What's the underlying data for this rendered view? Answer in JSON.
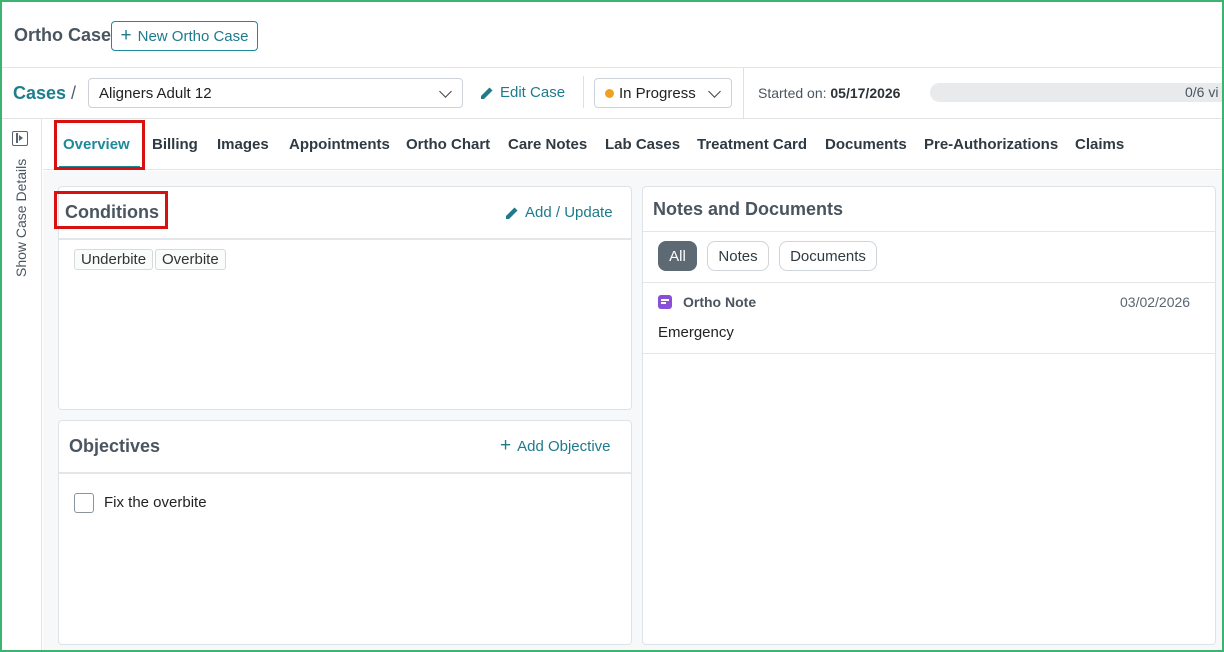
{
  "header": {
    "title": "Ortho Case",
    "new_case_label": "New Ortho Case"
  },
  "case_bar": {
    "breadcrumb_root": "Cases",
    "breadcrumb_sep": "/",
    "selected_case": "Aligners Adult 12",
    "edit_label": "Edit Case",
    "status": "In Progress",
    "status_color": "#f0a020",
    "started_label": "Started on:",
    "started_date": "05/17/2026",
    "progress_text": "0/6 vi",
    "progress_fraction": 0
  },
  "rail": {
    "label": "Show Case Details"
  },
  "tabs": [
    {
      "label": "Overview"
    },
    {
      "label": "Billing"
    },
    {
      "label": "Images"
    },
    {
      "label": "Appointments"
    },
    {
      "label": "Ortho Chart"
    },
    {
      "label": "Care Notes"
    },
    {
      "label": "Lab Cases"
    },
    {
      "label": "Treatment Card"
    },
    {
      "label": "Documents"
    },
    {
      "label": "Pre-Authorizations"
    },
    {
      "label": "Claims"
    }
  ],
  "conditions": {
    "title": "Conditions",
    "action_label": "Add / Update",
    "items": [
      "Underbite",
      "Overbite"
    ]
  },
  "objectives": {
    "title": "Objectives",
    "action_label": "Add Objective",
    "items": [
      {
        "label": "Fix the overbite",
        "checked": false
      }
    ]
  },
  "notes_docs": {
    "title": "Notes and Documents",
    "filters": [
      "All",
      "Notes",
      "Documents"
    ],
    "active_filter": "All",
    "entries": [
      {
        "type": "Ortho Note",
        "date": "03/02/2026",
        "body": "Emergency"
      }
    ]
  },
  "colors": {
    "accent": "#1e8a99",
    "highlight": "#d91010",
    "frame": "#3cb371"
  }
}
